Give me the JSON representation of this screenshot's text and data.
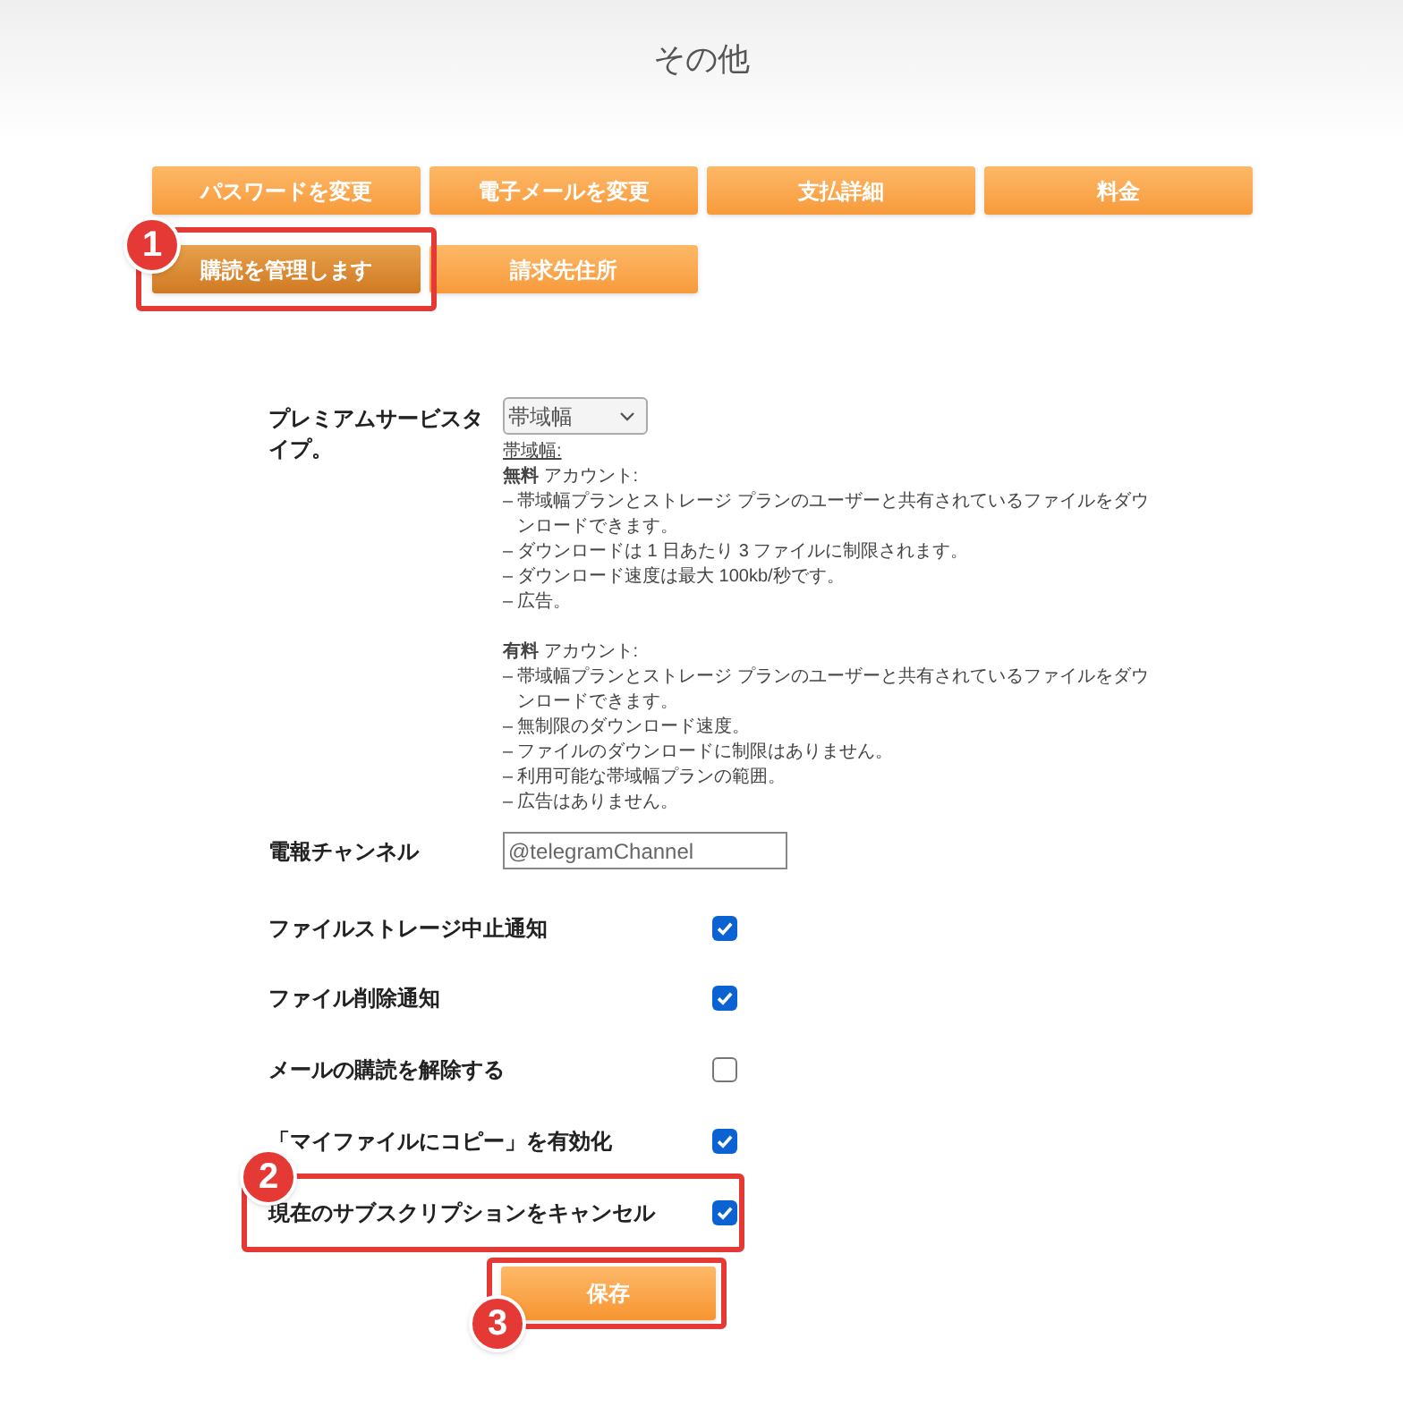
{
  "page_title": "その他",
  "nav_buttons": [
    {
      "label": "パスワードを変更",
      "selected": false
    },
    {
      "label": "電子メールを変更",
      "selected": false
    },
    {
      "label": "支払詳細",
      "selected": false
    },
    {
      "label": "料金",
      "selected": false
    },
    {
      "label": "購読を管理します",
      "selected": true,
      "callout": "1"
    },
    {
      "label": "請求先住所",
      "selected": false
    }
  ],
  "premium": {
    "label": "プレミアムサービスタイプ。",
    "select_value": "帯域幅",
    "heading": "帯域幅:",
    "sections": [
      {
        "title": "**無料** アカウント:",
        "items": [
          {
            "bullet": "–",
            "text": "帯域幅プランとストレージ プランのユーザーと共有されているファイルをダウンロードできます。"
          },
          {
            "bullet": "–",
            "text": "ダウンロードは 1 日あたり 3 ファイルに制限されます。"
          },
          {
            "bullet": "–",
            "text": "ダウンロード速度は最大 100kb/秒です。"
          },
          {
            "bullet": "–",
            "text": "広告。"
          }
        ]
      },
      {
        "title": "**有料** アカウント:",
        "items": [
          {
            "bullet": "–",
            "text": "帯域幅プランとストレージ プランのユーザーと共有されているファイルをダウンロードできます。"
          },
          {
            "bullet": "–",
            "text": "無制限のダウンロード速度。"
          },
          {
            "bullet": "–",
            "text": "ファイルのダウンロードに制限はありません。"
          },
          {
            "bullet": "–",
            "text": "利用可能な帯域幅プランの範囲。"
          },
          {
            "bullet": "–",
            "text": "広告はありません。"
          }
        ]
      }
    ]
  },
  "telegram": {
    "label": "電報チャンネル",
    "placeholder": "@telegramChannel"
  },
  "checkboxes": [
    {
      "label": "ファイルストレージ中止通知",
      "checked": true
    },
    {
      "label": "ファイル削除通知",
      "checked": true
    },
    {
      "label": "メールの購読を解除する",
      "checked": false
    },
    {
      "label": "「マイファイルにコピー」を有効化",
      "checked": true
    },
    {
      "label": "現在のサブスクリプションをキャンセル",
      "checked": true,
      "callout": "2"
    }
  ],
  "save_button": {
    "label": "保存",
    "callout": "3"
  }
}
